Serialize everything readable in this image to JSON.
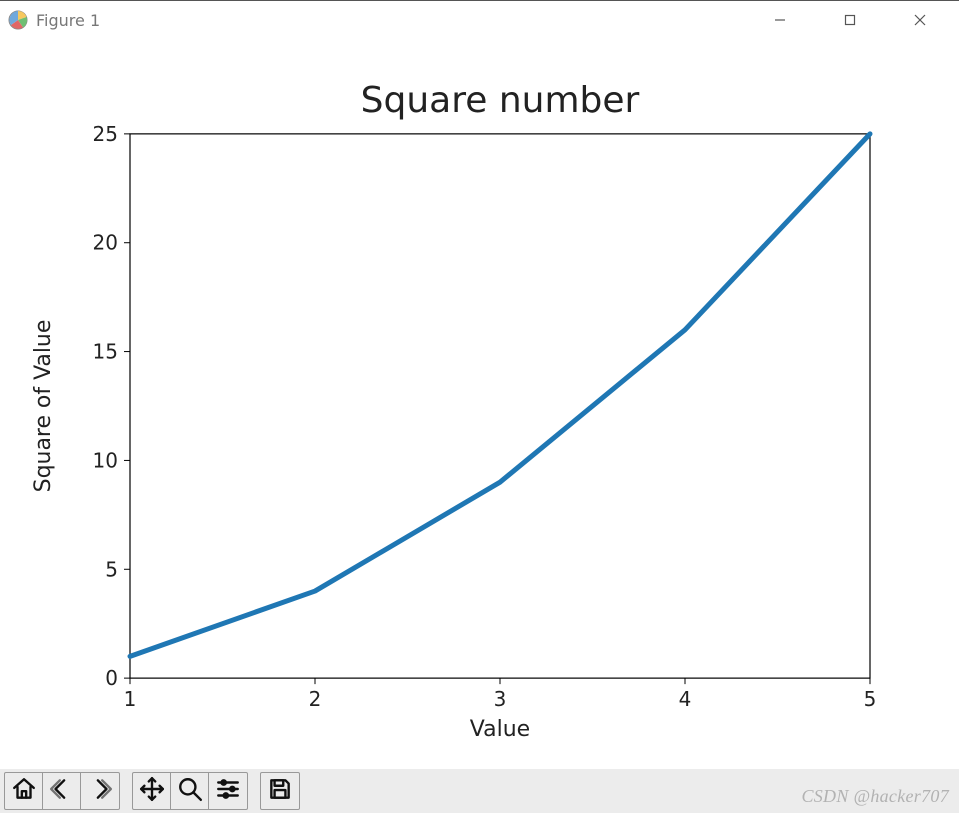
{
  "window": {
    "title": "Figure 1",
    "buttons": {
      "minimize": "Minimize",
      "maximize": "Maximize",
      "close": "Close"
    }
  },
  "toolbar": {
    "home": "Home",
    "back": "Back",
    "forward": "Forward",
    "pan": "Pan",
    "zoom": "Zoom",
    "configure": "Configure subplots",
    "save": "Save"
  },
  "watermark": "CSDN @hacker707",
  "chart_data": {
    "type": "line",
    "title": "Square number",
    "xlabel": "Value",
    "ylabel": "Square of Value",
    "x": [
      1,
      2,
      3,
      4,
      5
    ],
    "y": [
      1,
      4,
      9,
      16,
      25
    ],
    "xlim": [
      1,
      5
    ],
    "ylim": [
      0,
      25
    ],
    "xticks": [
      1,
      2,
      3,
      4,
      5
    ],
    "yticks": [
      0,
      5,
      10,
      15,
      20,
      25
    ],
    "line_color": "#1f77b4",
    "line_width": 5,
    "grid": false
  }
}
